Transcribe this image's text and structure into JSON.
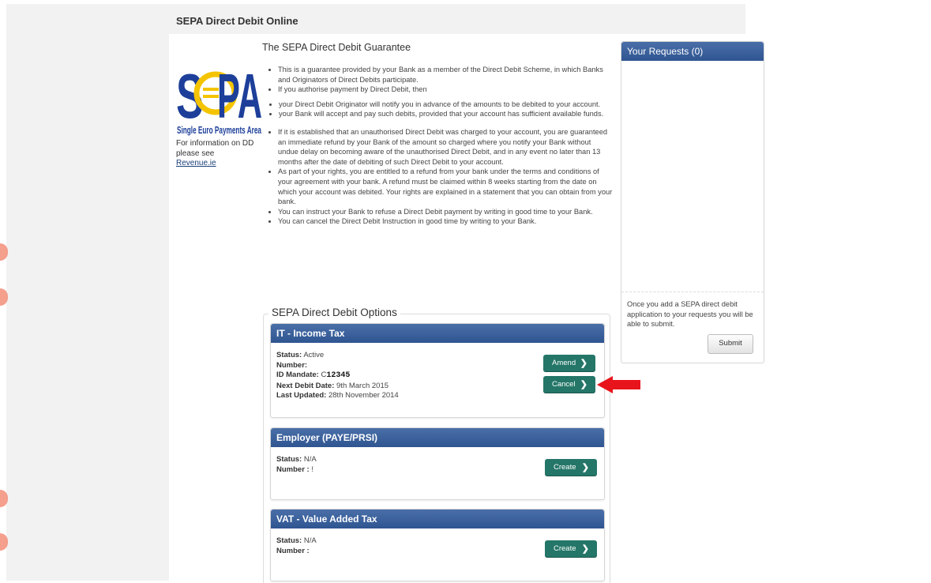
{
  "app": {
    "title": "SEPA Direct Debit Online"
  },
  "logo": {
    "subtitle": "Single Euro Payments Area",
    "brand_colors": {
      "blue": "#1d3f9a",
      "yellow": "#f5c400"
    }
  },
  "sidebar": {
    "info_text": "For information on DD please see",
    "link_text": "Revenue.ie"
  },
  "guarantee": {
    "title": "The SEPA Direct Debit Guarantee",
    "bullets": [
      "This is a guarantee provided by your Bank as a member of the Direct Debit Scheme, in which Banks and Originators of Direct Debits participate.",
      "If you authorise payment by Direct Debit, then"
    ],
    "sub_bullets": [
      "your Direct Debit Originator will notify you in advance of the amounts to be debited to your account.",
      "your Bank will accept and pay such debits, provided that your account has sufficient available funds."
    ],
    "more_bullets": [
      "If it is established that an unauthorised Direct Debit was charged to your account, you are guaranteed an immediate refund by your Bank of the amount so charged where you notify your Bank without undue delay on becoming aware of the unauthorised Direct Debit, and in any event no later than 13 months after the date of debiting of such Direct Debit to your account.",
      "As part of your rights, you are entitled to a refund from your bank under the terms and conditions of your agreement with your bank. A refund must be claimed within 8 weeks starting from the date on which your account was debited. Your rights are explained in a statement that you can obtain from your bank.",
      "You can instruct your Bank to refuse a Direct Debit payment by writing in good time to your Bank.",
      "You can cancel the Direct Debit Instruction in good time by writing to your Bank."
    ]
  },
  "options": {
    "legend": "SEPA Direct Debit Options",
    "income_tax": {
      "title": "IT - Income Tax",
      "status_label": "Status:",
      "status_value": "Active",
      "number_label": "Number:",
      "mandate_label": "ID Mandate:",
      "mandate_prefix": "C",
      "mandate_value": "12345",
      "next_label": "Next Debit Date:",
      "next_value": "9th March 2015",
      "updated_label": "Last Updated:",
      "updated_value": "28th November 2014",
      "amend_label": "Amend",
      "cancel_label": "Cancel"
    },
    "employer": {
      "title": "Employer (PAYE/PRSI)",
      "status_label": "Status:",
      "status_value": "N/A",
      "number_label": "Number :",
      "number_value": "!",
      "create_label": "Create"
    },
    "vat": {
      "title": "VAT - Value Added Tax",
      "status_label": "Status:",
      "status_value": "N/A",
      "number_label": "Number :",
      "create_label": "Create"
    }
  },
  "requests": {
    "title": "Your Requests (0)",
    "note": "Once you add a SEPA direct debit application to your requests you will be able to submit.",
    "submit_label": "Submit"
  },
  "colors": {
    "header_blue": "#2f5591",
    "button_teal": "#247668",
    "arrow_red": "#e8141c"
  }
}
